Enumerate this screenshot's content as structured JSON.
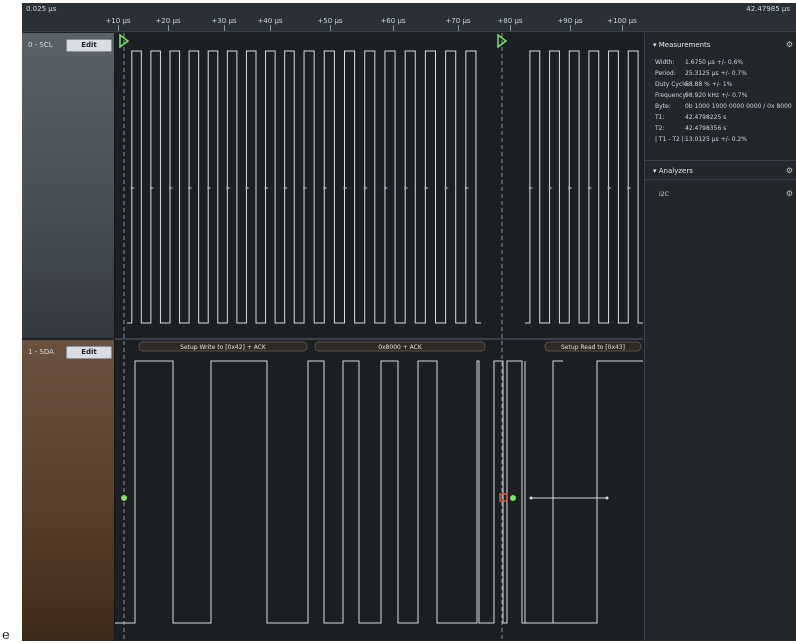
{
  "timebar": {
    "left_corner": "0.025 µs",
    "right_corner": "42.47985 µs",
    "ticks": [
      "+10 µs",
      "+20 µs",
      "+30 µs",
      "+40 µs",
      "+50 µs",
      "+60 µs",
      "+70 µs",
      "+80 µs",
      "+90 µs",
      "+100 µs"
    ]
  },
  "channels": [
    {
      "name": "0 - SCL",
      "button_label": "Edit",
      "color": "#6a7078"
    },
    {
      "name": "1 - SDA",
      "button_label": "Edit",
      "color": "#7a5a3c"
    }
  ],
  "decoder_labels": [
    "Setup Write to [0x42] + ACK",
    "0x8000 + ACK",
    "Setup Read to [0x43]"
  ],
  "measurements": {
    "title": "Measurements",
    "rows": [
      {
        "label": "Width:",
        "value": "1.6750 µs +/- 0.6%"
      },
      {
        "label": "Period:",
        "value": "25.3125 µs +/- 0.7%"
      },
      {
        "label": "Duty Cycle:",
        "value": "58.88 % +/- 1%"
      },
      {
        "label": "Frequency:",
        "value": "98.920 kHz +/- 0.7%"
      },
      {
        "label": "Byte:",
        "value": "0b 1000 1000 0000 0000 / 0x 8000"
      },
      {
        "label": "T1:",
        "value": "42.4798225 s"
      },
      {
        "label": "T2:",
        "value": "42.4798356 s"
      },
      {
        "label": "| T1 - T2 |:",
        "value": "13.0125 µs +/- 0.2%"
      }
    ]
  },
  "analyzers": {
    "title": "Analyzers",
    "items": [
      "I2C"
    ]
  },
  "stray_text": "e",
  "colors": {
    "trigger": "#7ee06a",
    "marker_green": "#7ee06a",
    "marker_red": "#e0603a",
    "trace": "#d8dde2",
    "decoder_bar": "#2e2a25"
  }
}
